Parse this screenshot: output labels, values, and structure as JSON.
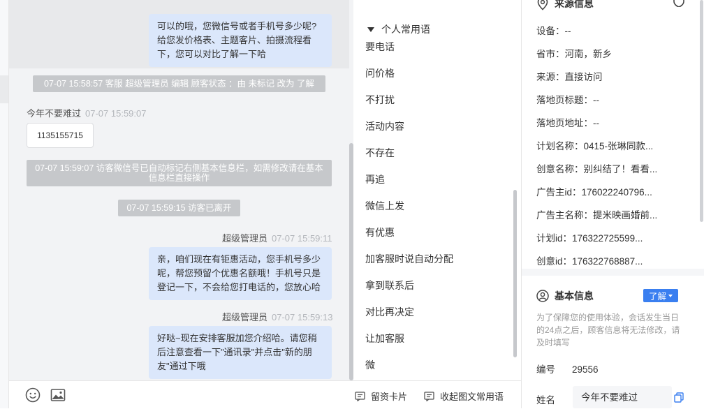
{
  "chat": {
    "messages": [
      {
        "type": "agent",
        "text": "可以的哦，您微信号或者手机号多少呢?给您发价格表、主题客片、拍摄流程看下，您可以对比了解一下哈"
      },
      {
        "type": "system",
        "text": "07-07 15:58:57 客服 超级管理员 编辑 顾客状态 ：由 未标记 改为 了解"
      },
      {
        "type": "visitor",
        "sender": "今年不要难过",
        "time": "07-07 15:59:07",
        "text": "1135155715"
      },
      {
        "type": "system",
        "text": "07-07 15:59:07 访客微信号已自动标记右侧基本信息栏，如需修改请在基本信息栏直接操作"
      },
      {
        "type": "system",
        "text": "07-07 15:59:15 访客已离开"
      },
      {
        "type": "agent",
        "sender": "超级管理员",
        "time": "07-07 15:59:11",
        "text": "亲，咱们现在有钜惠活动，您手机号多少呢，帮您预留个优惠名额哦！手机号只是登记一下，不会给您打电话的，您放心哈"
      },
      {
        "type": "agent",
        "sender": "超级管理员",
        "time": "07-07 15:59:13",
        "text": "好哒~现在安排客服加您介绍哈。请您稍后注意查看一下\"通讯录\"并点击\"新的朋友\"通过下哦"
      }
    ]
  },
  "toolbar": {
    "emoji_icon": "smiley-icon",
    "image_icon": "image-icon",
    "card_label": "留资卡片",
    "phrases_label": "收起图文常用语"
  },
  "phrases": {
    "header": "个人常用语",
    "items": [
      "要电话",
      "问价格",
      "不打扰",
      "活动内容",
      "不存在",
      "再追",
      "微信上发",
      "有优惠",
      "加客服时说自动分配",
      "拿到联系后",
      "对比再决定",
      "让加客服",
      "微"
    ]
  },
  "info": {
    "source_title": "来源信息",
    "source_rows": [
      {
        "label": "设备：",
        "value": "--"
      },
      {
        "label": "省市：",
        "value": "河南，新乡"
      },
      {
        "label": "来源：",
        "value": "直接访问"
      },
      {
        "label": "落地页标题：",
        "value": "--"
      },
      {
        "label": "落地页地址：",
        "value": "--"
      },
      {
        "label": "计划名称：",
        "value": "0415-张琳同款..."
      },
      {
        "label": "创意名称：",
        "value": "别纠结了！看看..."
      },
      {
        "label": "广告主id：",
        "value": "176022240796..."
      },
      {
        "label": "广告主名称：",
        "value": "提米映画婚前..."
      },
      {
        "label": "计划id：",
        "value": "176322725599..."
      },
      {
        "label": "创意id：",
        "value": "176322768887..."
      }
    ],
    "basic_title": "基本信息",
    "status_badge": "了解",
    "note": "为了保障您的使用体验，会话发生当日的24点之后，顾客信息将无法修改，请及时填写",
    "number_label": "编号",
    "number_value": "29556",
    "name_label": "姓名",
    "name_value": "今年不要难过"
  },
  "colors": {
    "accent": "#3a7ff0",
    "agent_bubble": "#dbe7fb",
    "system_bg": "#c6c8cb"
  }
}
